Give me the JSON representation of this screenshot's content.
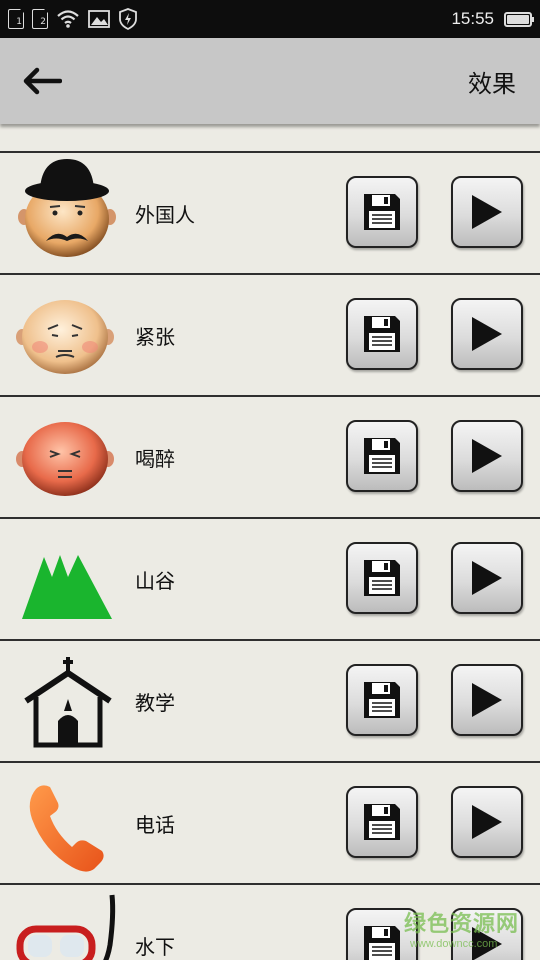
{
  "status_bar": {
    "sim1": "1",
    "sim2": "2",
    "time": "15:55",
    "battery_level": 1.0
  },
  "toolbar": {
    "title": "效果",
    "back_icon": "arrow-left-icon"
  },
  "effects": [
    {
      "label": "外国人",
      "icon": "foreigner-face-icon"
    },
    {
      "label": "紧张",
      "icon": "nervous-face-icon"
    },
    {
      "label": "喝醉",
      "icon": "drunk-face-icon"
    },
    {
      "label": "山谷",
      "icon": "valley-mountains-icon"
    },
    {
      "label": "教学",
      "icon": "church-icon"
    },
    {
      "label": "电话",
      "icon": "telephone-icon"
    },
    {
      "label": "水下",
      "icon": "diving-mask-icon"
    }
  ],
  "row_actions": {
    "save_icon": "floppy-disk-icon",
    "play_icon": "play-icon"
  },
  "watermark": {
    "text": "绿色资源网",
    "url": "www.downcc.com"
  }
}
